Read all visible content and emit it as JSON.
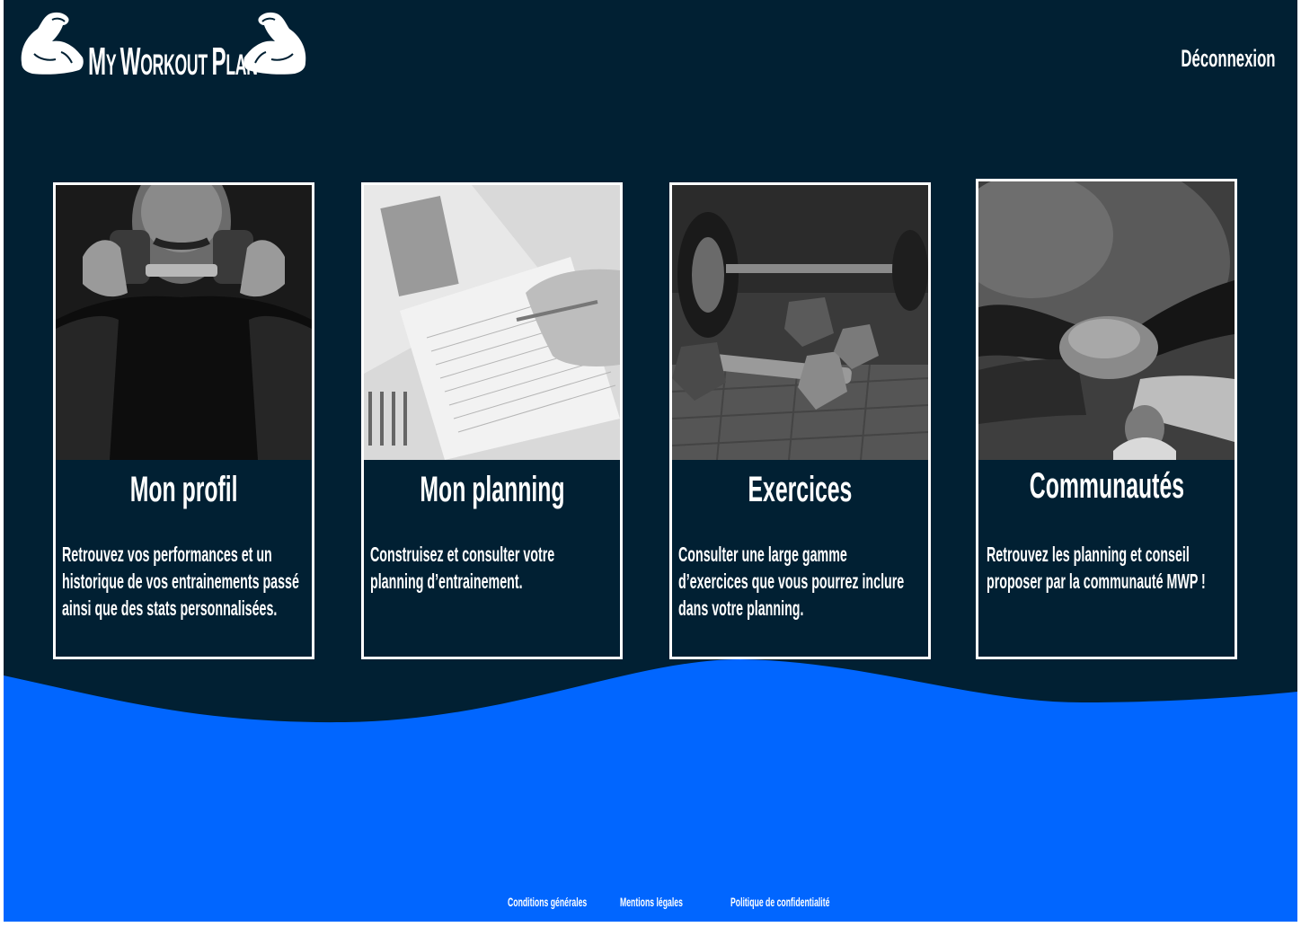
{
  "app": {
    "logo_text": "My Workout Plan",
    "logo_parts": [
      "M",
      "Y ",
      "W",
      "ORKOUT ",
      "P",
      "LAN"
    ],
    "logout_label": "Déconnexion"
  },
  "colors": {
    "background": "#012033",
    "wave": "#0166FF",
    "text": "#FFFFFF",
    "card_border": "#FFFFFF"
  },
  "cards": [
    {
      "title": "Mon profil",
      "description": "Retrouvez vos performances et un historique de vos entrainements passé ainsi que des stats personnalisées.",
      "image": "athlete-photo"
    },
    {
      "title": "Mon planning",
      "description": "Construisez et consulter votre planning d’entrainement.",
      "image": "planner-notebook-photo"
    },
    {
      "title": "Exercices",
      "description": "Consulter une large gamme d’exercices que vous pourrez inclure dans votre planning.",
      "image": "dumbbells-photo"
    },
    {
      "title": "Communautés",
      "description": "Retrouvez les planning et conseil proposer par la communauté MWP !",
      "image": "team-hands-photo"
    }
  ],
  "footer": {
    "links": [
      "Conditions générales",
      "Mentions légales",
      "Politique de confidentialité"
    ]
  }
}
